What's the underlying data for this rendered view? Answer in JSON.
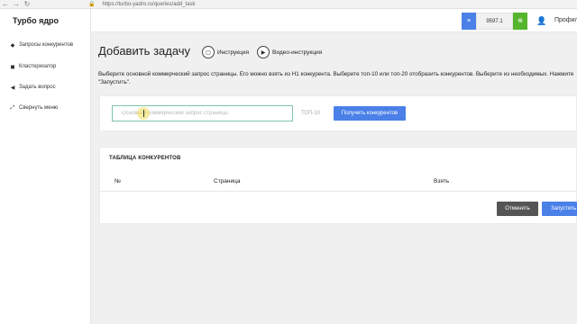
{
  "browser": {
    "url": "https://turbo-yadro.ru/queries/add_task",
    "back_icon": "←",
    "forward_icon": "→",
    "reload_icon": "↻"
  },
  "sidebar": {
    "logo": "Турбо ядро",
    "items": [
      {
        "label": "Запросы конкурентов",
        "icon": "pin-icon",
        "glyph": "◆"
      },
      {
        "label": "Кластеризатор",
        "icon": "tag-icon",
        "glyph": "◼"
      },
      {
        "label": "Задать вопрос",
        "icon": "send-icon",
        "glyph": "◀"
      },
      {
        "label": "Свернуть меню",
        "icon": "collapse-icon",
        "glyph": "⤢"
      }
    ]
  },
  "header": {
    "balance": "9597.1",
    "profile_label": "Профиль",
    "accent_blue": "#4a80e8",
    "accent_green": "#55b52d"
  },
  "main": {
    "title": "Добавить задачу",
    "instruction_link": "Инструкция",
    "video_link": "Видео-инструкция",
    "description": "Выберите основной коммерческий запрос страницы. Его можно взять из H1 конкурента. Выберите топ-10 или топ-20 отобразить конкурентов. Выберите из необходимых. Нажмите \"Запустить\".",
    "query_placeholder": "Основной коммерческий запрос страницы",
    "top_select_value": "ТОП-10",
    "get_competitors_button": "Получить конкурентов",
    "table": {
      "title": "ТАБЛИЦА КОНКУРЕНТОВ",
      "columns": [
        "№",
        "Страница",
        "Взять"
      ]
    },
    "cancel_button": "Отменить",
    "run_button": "Запустить"
  }
}
